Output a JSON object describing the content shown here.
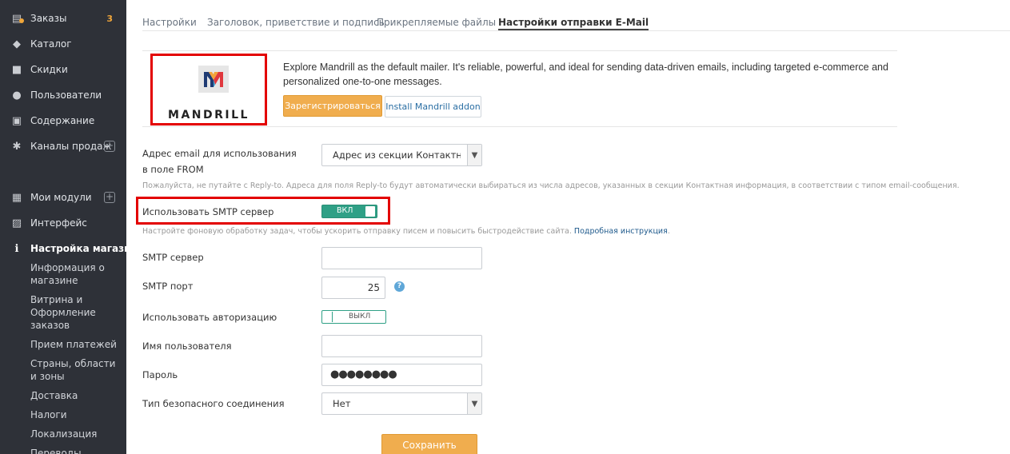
{
  "sidebar": {
    "items": [
      {
        "label": "Заказы",
        "icon": "orders-icon",
        "badge": "3"
      },
      {
        "label": "Каталог",
        "icon": "tag-icon"
      },
      {
        "label": "Скидки",
        "icon": "gift-icon"
      },
      {
        "label": "Пользователи",
        "icon": "users-icon"
      },
      {
        "label": "Содержание",
        "icon": "content-icon"
      },
      {
        "label": "Каналы продаж",
        "icon": "channels-icon"
      },
      {
        "label": "Мои модули",
        "icon": "modules-icon"
      },
      {
        "label": "Интерфейс",
        "icon": "interface-icon"
      },
      {
        "label": "Настройка магазина",
        "icon": "info-icon"
      }
    ],
    "subitems": [
      "Информация о магазине",
      "Витрина и Оформление заказов",
      "Прием платежей",
      "Страны, области и зоны",
      "Доставка",
      "Налоги",
      "Локализация",
      "Переводы"
    ]
  },
  "tabs": [
    {
      "label": "Настройки"
    },
    {
      "label": "Заголовок, приветствие и подпись"
    },
    {
      "label": "Прикрепляемые файлы"
    },
    {
      "label": "Настройки отправки E-Mail"
    }
  ],
  "banner": {
    "logo_text": "MANDRILL",
    "text": "Explore Mandrill as the default mailer. It's reliable, powerful, and ideal for sending data-driven emails, including targeted e-commerce and personalized one-to-one messages.",
    "register_label": "Зарегистрироваться",
    "addon_label": "Install Mandrill addon"
  },
  "form": {
    "from_label": "Адрес email для использования в поле FROM",
    "from_value": "Адрес из секции Контактная и",
    "from_hint": "Пожалуйста, не путайте с Reply-to. Адреса для поля Reply-to будут автоматически выбираться из числа адресов, указанных в секции Контактная информация, в соответствии с типом email-сообщения.",
    "smtp_use_label": "Использовать SMTP сервер",
    "smtp_use_toggle": "ВКЛ",
    "smtp_hint_text": "Настройте фоновую обработку задач, чтобы ускорить отправку писем и повысить быстродействие сайта.",
    "smtp_hint_link": "Подробная инструкция",
    "smtp_server_label": "SMTP сервер",
    "smtp_server_value": "",
    "smtp_port_label": "SMTP порт",
    "smtp_port_value": "25",
    "auth_label": "Использовать авторизацию",
    "auth_toggle": "ВЫКЛ",
    "username_label": "Имя пользователя",
    "username_value": "",
    "password_label": "Пароль",
    "password_value": "●●●●●●●●",
    "secure_label": "Тип безопасного соединения",
    "secure_value": "Нет",
    "save_label": "Сохранить"
  },
  "colors": {
    "sidebar_bg": "#2e3138",
    "accent_orange": "#f0ad4e",
    "toggle_green": "#2fa086",
    "highlight_red": "#e30000"
  }
}
